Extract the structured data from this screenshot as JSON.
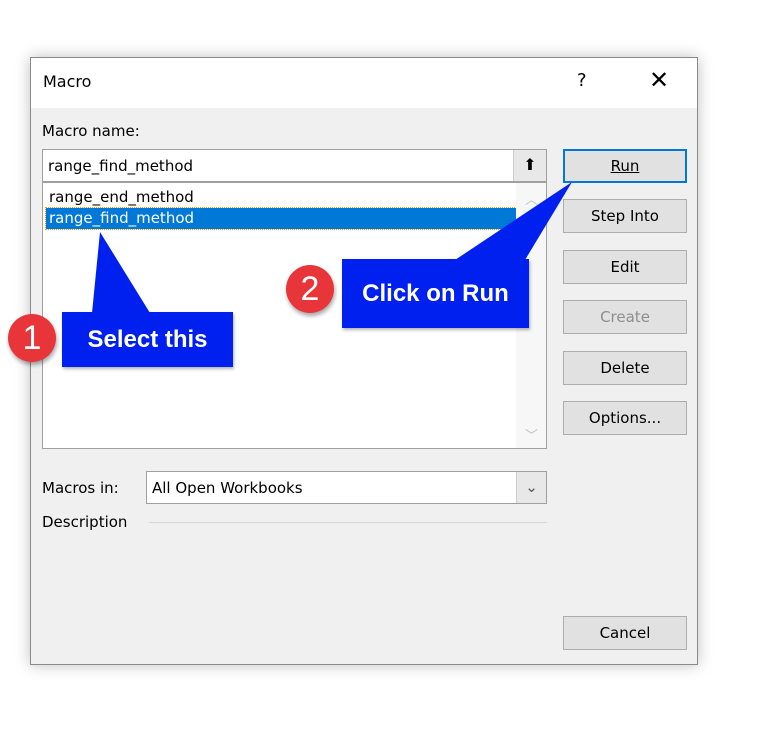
{
  "dialog": {
    "title": "Macro",
    "help": "?",
    "close": "✕"
  },
  "macro_name": {
    "label": "Macro name:",
    "value": "range_find_method",
    "up_icon": "⬆"
  },
  "macro_list": {
    "items": [
      "range_end_method",
      "range_find_method"
    ],
    "selected_index": 1
  },
  "buttons": {
    "run": "Run",
    "step_into": "Step Into",
    "edit": "Edit",
    "create": "Create",
    "delete": "Delete",
    "options": "Options...",
    "cancel": "Cancel"
  },
  "macros_in": {
    "label": "Macros in:",
    "value": "All Open Workbooks"
  },
  "description": {
    "label": "Description"
  },
  "annotations": [
    {
      "number": "1",
      "text": "Select this"
    },
    {
      "number": "2",
      "text": "Click on Run"
    }
  ],
  "colors": {
    "selection": "#0078d7",
    "callout": "#0020f0",
    "badge": "#e8353a"
  }
}
